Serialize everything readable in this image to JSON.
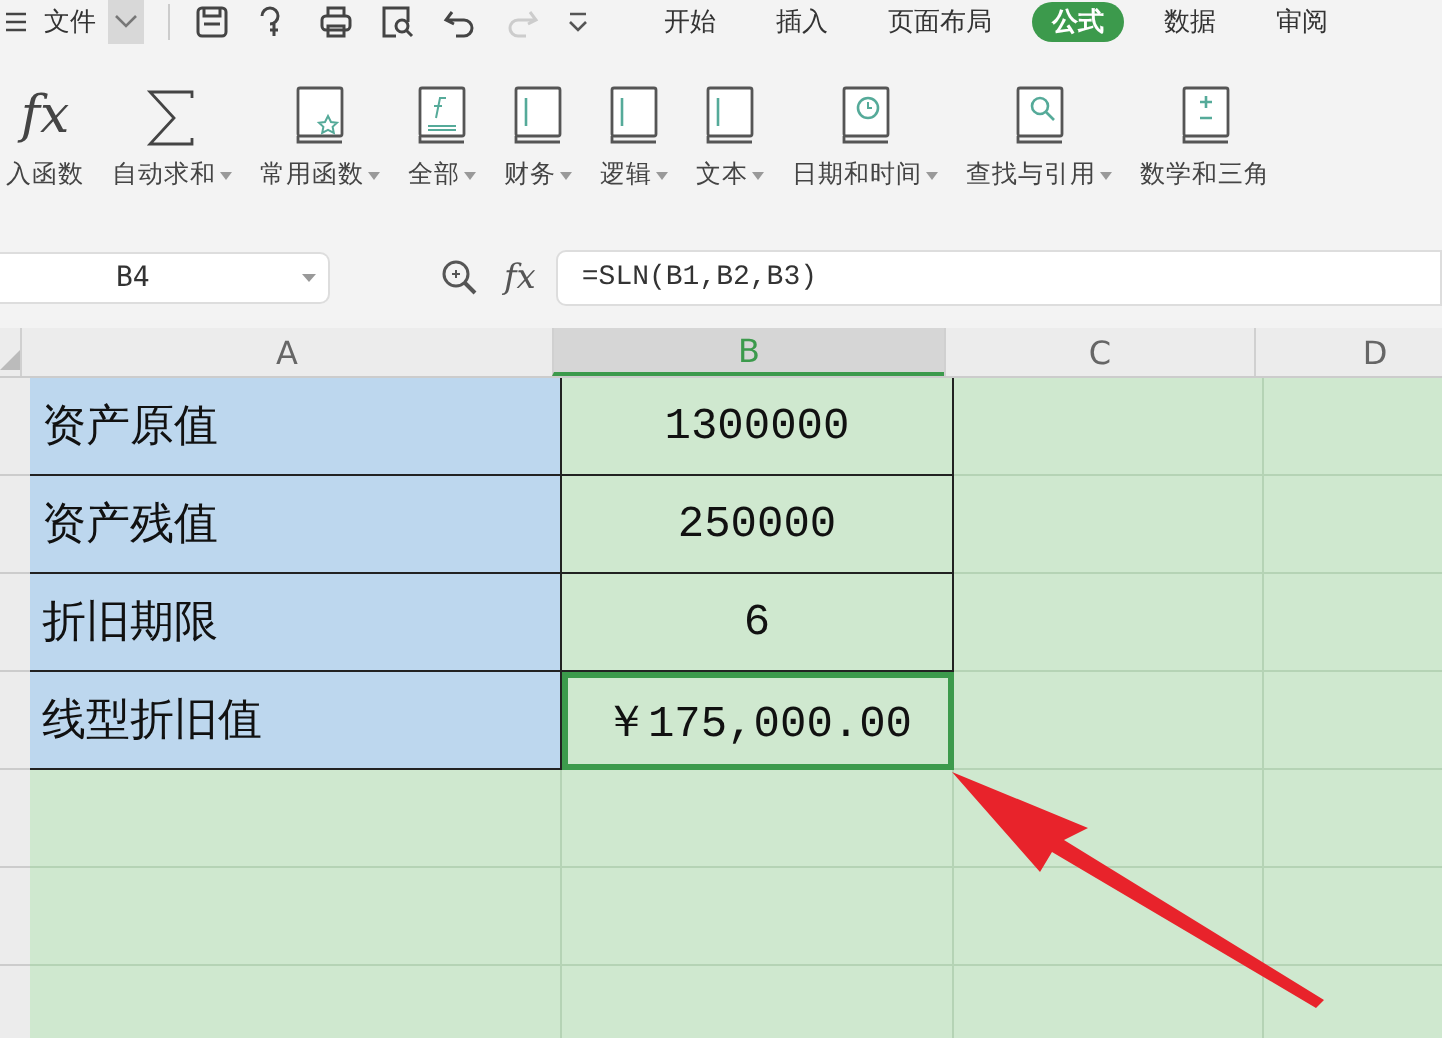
{
  "menu": {
    "label": "文件"
  },
  "tabs": [
    {
      "label": "开始",
      "selected": false
    },
    {
      "label": "插入",
      "selected": false
    },
    {
      "label": "页面布局",
      "selected": false
    },
    {
      "label": "公式",
      "selected": true
    },
    {
      "label": "数据",
      "selected": false
    },
    {
      "label": "审阅",
      "selected": false
    }
  ],
  "ribbon": [
    {
      "label": "入函数",
      "dropdown": false,
      "icon": "fx"
    },
    {
      "label": "自动求和",
      "dropdown": true
    },
    {
      "label": "常用函数",
      "dropdown": true
    },
    {
      "label": "全部",
      "dropdown": true
    },
    {
      "label": "财务",
      "dropdown": true
    },
    {
      "label": "逻辑",
      "dropdown": true
    },
    {
      "label": "文本",
      "dropdown": true
    },
    {
      "label": "日期和时间",
      "dropdown": true
    },
    {
      "label": "查找与引用",
      "dropdown": true
    },
    {
      "label": "数学和三角",
      "dropdown": false
    }
  ],
  "name_box": {
    "value": "B4"
  },
  "formula": {
    "icon": "fx",
    "value": "=SLN(B1,B2,B3)"
  },
  "columns": [
    {
      "label": "A",
      "selected": false
    },
    {
      "label": "B",
      "selected": true
    },
    {
      "label": "C",
      "selected": false
    },
    {
      "label": "D",
      "selected": false
    }
  ],
  "rows": [
    {
      "cells": [
        {
          "text": "资产原值",
          "selected": false
        },
        {
          "text": "1300000",
          "selected": false
        }
      ]
    },
    {
      "cells": [
        {
          "text": "资产残值",
          "selected": false
        },
        {
          "text": "250000",
          "selected": false
        }
      ]
    },
    {
      "cells": [
        {
          "text": "折旧期限",
          "selected": false
        },
        {
          "text": "6",
          "selected": false
        }
      ]
    },
    {
      "cells": [
        {
          "text": "线型折旧值",
          "selected": false
        },
        {
          "text": "￥175,000.00",
          "selected": true
        }
      ]
    }
  ]
}
